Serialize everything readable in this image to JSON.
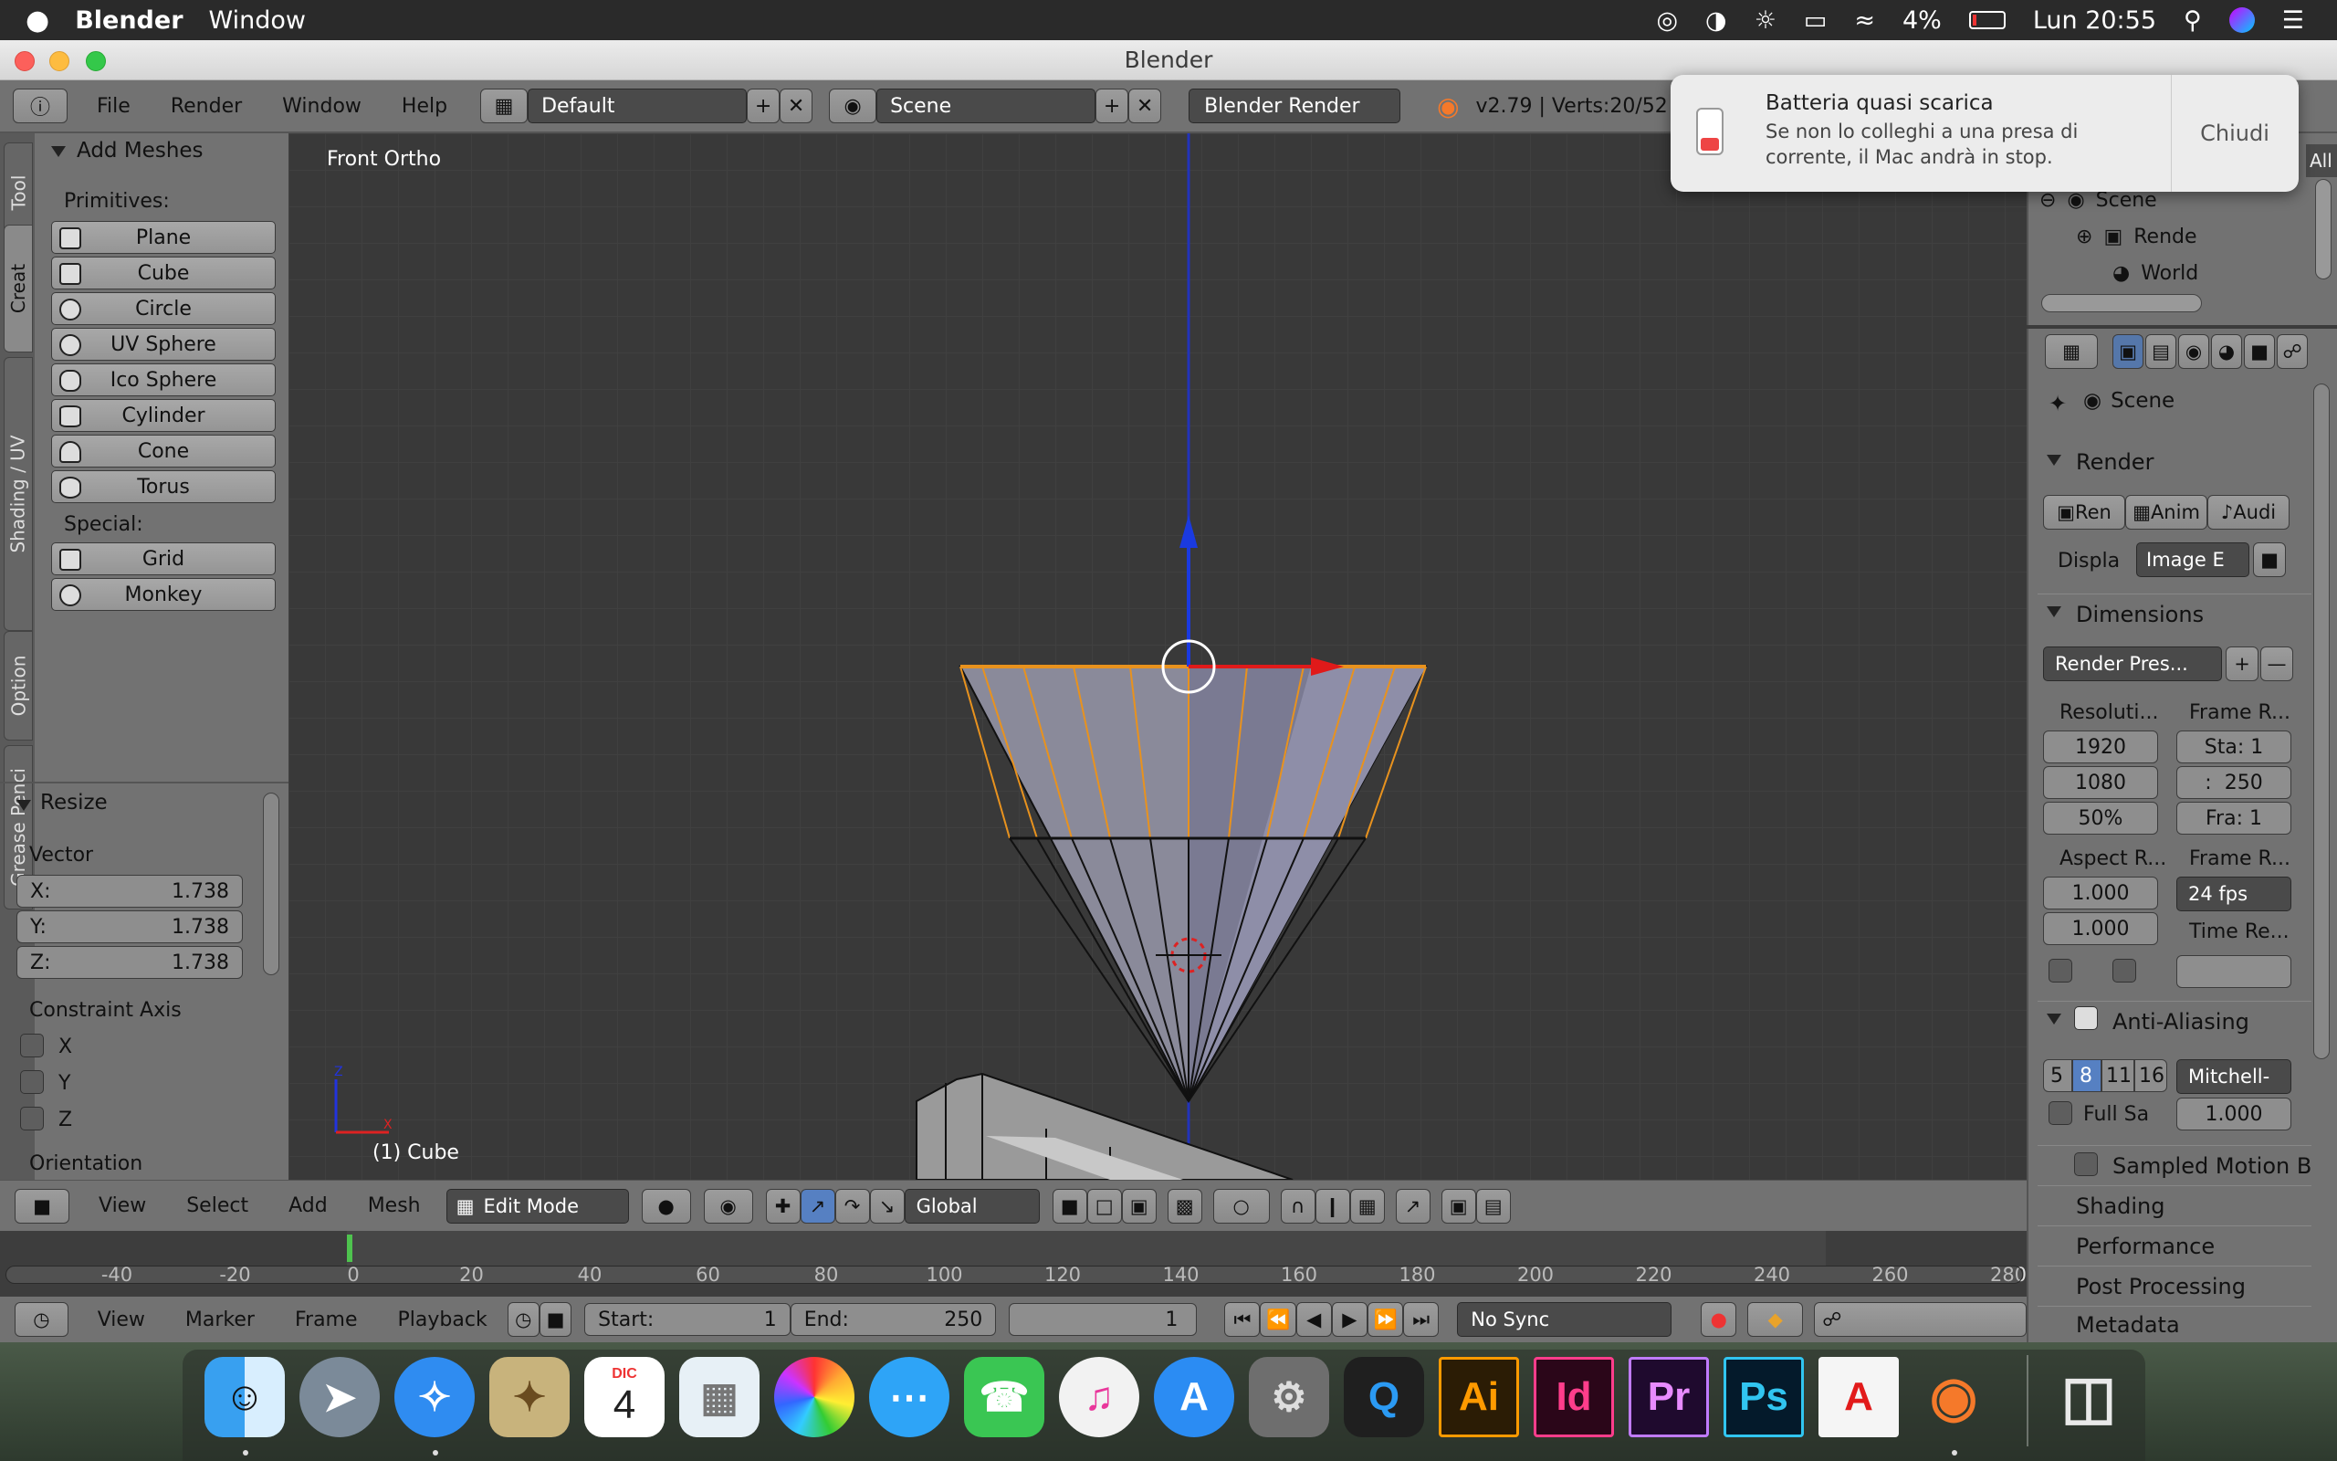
{
  "menubar": {
    "apple": "",
    "app": "Blender",
    "window": "Window",
    "battery": "4%",
    "clock": "Lun 20:55"
  },
  "titlebar": {
    "title": "Blender"
  },
  "header": {
    "menus": [
      "File",
      "Render",
      "Window",
      "Help"
    ],
    "screen_layout": "Default",
    "scene": "Scene",
    "engine": "Blender Render",
    "version_stats": "v2.79 | Verts:20/52"
  },
  "notification": {
    "title": "Batteria quasi scarica",
    "body_line1": "Se non lo colleghi a una presa di",
    "body_line2": "corrente, il Mac andrà in stop.",
    "close": "Chiudi"
  },
  "tabs": [
    "Tool",
    "Creat",
    "Shading / UV",
    "Option",
    "Grease Penci"
  ],
  "toolshelf": {
    "panel_title": "Add Meshes",
    "primitives_label": "Primitives:",
    "primitives": [
      "Plane",
      "Cube",
      "Circle",
      "UV Sphere",
      "Ico Sphere",
      "Cylinder",
      "Cone",
      "Torus"
    ],
    "special_label": "Special:",
    "special": [
      "Grid",
      "Monkey"
    ]
  },
  "operator": {
    "title": "Resize",
    "vector_label": "Vector",
    "x_label": "X:",
    "x": "1.738",
    "y_label": "Y:",
    "y": "1.738",
    "z_label": "Z:",
    "z": "1.738",
    "constraint_label": "Constraint Axis",
    "axes": [
      "X",
      "Y",
      "Z"
    ],
    "orientation_label": "Orientation"
  },
  "viewport": {
    "view_name": "Front Ortho",
    "object_label": "(1) Cube",
    "axis_z": "Z",
    "axis_x": "X"
  },
  "outliner": {
    "items": [
      "Scene",
      "Rende",
      "World"
    ],
    "all": "All"
  },
  "properties": {
    "context": "Scene",
    "render_panel": "Render",
    "render_btn": "Ren",
    "anim_btn": "Anim",
    "audio_btn": "Audi",
    "display_label": "Displa",
    "display_value": "Image E",
    "dimensions_panel": "Dimensions",
    "render_presets": "Render Pres...",
    "resolution_label": "Resoluti...",
    "res_x": "1920",
    "res_y": "1080",
    "res_pct": "50%",
    "frame_range_label": "Frame R...",
    "start": "Sta: 1",
    "end": ":  250",
    "frame_step": "Fra: 1",
    "aspect_label": "Aspect R...",
    "aspect_x": "1.000",
    "aspect_y": "1.000",
    "frame_rate_label": "Frame R...",
    "fps": "24 fps",
    "time_remap_label": "Time Re...",
    "aa_panel": "Anti-Aliasing",
    "aa_samples": [
      "5",
      "8",
      "11",
      "16"
    ],
    "aa_filter": "Mitchell-",
    "full_sample": "Full Sa",
    "filter_size": "1.000",
    "motion_blur": "Sampled Motion Bl",
    "shading": "Shading",
    "performance": "Performance",
    "post_processing": "Post Processing",
    "metadata": "Metadata"
  },
  "view3d_header": {
    "menus": [
      "View",
      "Select",
      "Add",
      "Mesh"
    ],
    "mode": "Edit Mode",
    "orientation": "Global"
  },
  "timeline": {
    "ticks": [
      "-40",
      "-20",
      "0",
      "20",
      "40",
      "60",
      "80",
      "100",
      "120",
      "140",
      "160",
      "180",
      "200",
      "220",
      "240",
      "260",
      "280"
    ]
  },
  "timeline_header": {
    "menus": [
      "View",
      "Marker",
      "Frame",
      "Playback"
    ],
    "start": "Start:",
    "start_val": "1",
    "end": "End:",
    "end_val": "250",
    "current": "1",
    "sync": "No Sync"
  },
  "dock": {
    "apps": [
      "Finder",
      "Launchpad",
      "Safari",
      "Mail",
      "Calendar",
      "Preview",
      "Photos",
      "Messages",
      "FaceTime",
      "iTunes",
      "App Store",
      "System Preferences",
      "QuickTime",
      "Illustrator",
      "InDesign",
      "Premiere",
      "Photoshop",
      "Acrobat",
      "Blender",
      "Trash"
    ],
    "calendar_month": "DIC",
    "calendar_day": "4",
    "ai": "Ai",
    "id": "Id",
    "pr": "Pr",
    "ps": "Ps"
  }
}
